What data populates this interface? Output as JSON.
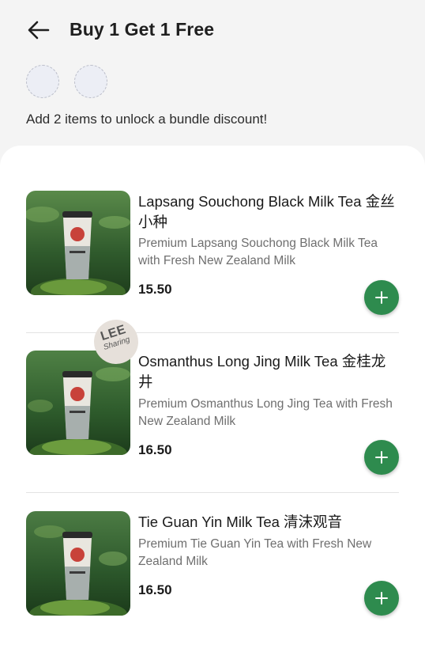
{
  "header": {
    "title": "Buy 1 Get 1 Free"
  },
  "bundle": {
    "hint": "Add 2 items to unlock a bundle discount!"
  },
  "badge": {
    "line1": "LEE",
    "line2": "Sharing"
  },
  "products": [
    {
      "name": "Lapsang Souchong Black Milk Tea 金丝小种",
      "description": "Premium Lapsang Souchong Black Milk Tea with Fresh New Zealand Milk",
      "price": "15.50"
    },
    {
      "name": "Osmanthus Long Jing Milk Tea 金桂龙井",
      "description": "Premium Osmanthus Long Jing Tea with Fresh New Zealand Milk",
      "price": "16.50"
    },
    {
      "name": "Tie Guan Yin Milk Tea 清沫观音",
      "description": "Premium Tie Guan Yin Tea with Fresh New Zealand Milk",
      "price": "16.50"
    }
  ],
  "colors": {
    "accent": "#2e8b4e",
    "background": "#f4f4f4"
  },
  "icons": {
    "back": "arrow-left-icon",
    "add": "plus-icon"
  }
}
